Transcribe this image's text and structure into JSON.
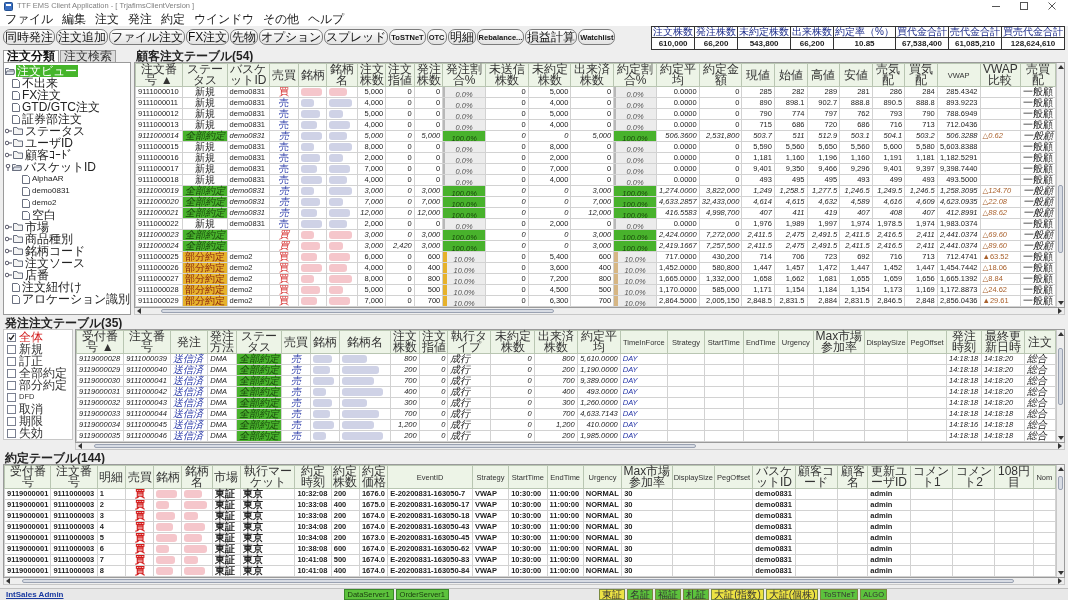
{
  "window": {
    "title": "TTF EMS Client Application - [ TrjafimsClientVersion ]"
  },
  "menu": [
    "ファイル",
    "編集",
    "注文",
    "発注",
    "約定",
    "ウインドウ",
    "その他",
    "ヘルプ"
  ],
  "toolbar": [
    "同時発注",
    "注文追加",
    "ファイル注文",
    "FX注文",
    "先物",
    "オプション",
    "スプレッド",
    "ToSTNeT",
    "OTC",
    "明細",
    "Rebalance...",
    "損益計算",
    "Watchlist"
  ],
  "summary": {
    "columns": [
      "注文株数",
      "発注株数",
      "未約定株数",
      "出来株数",
      "約定率（%）",
      "買代金合計",
      "売代金合計",
      "買売代金合計"
    ],
    "values": [
      "610,000",
      "66,200",
      "543,800",
      "66,200",
      "10.85",
      "67,538,400",
      "61,085,210",
      "128,624,610"
    ]
  },
  "left_panel": {
    "tabs": [
      {
        "label": "注文分類",
        "selected": true
      },
      {
        "label": "注文検索",
        "selected": false
      }
    ],
    "tree": [
      {
        "label": "注文ビュー",
        "kind": "folder",
        "expanded": true,
        "selected": true,
        "children": [
          {
            "label": "不出来",
            "kind": "document",
            "selected": false
          },
          {
            "label": "FX注文",
            "kind": "document",
            "selected": false
          },
          {
            "label": "GTD/GTC注文",
            "kind": "document",
            "selected": false
          },
          {
            "label": "証券部注文",
            "kind": "document",
            "selected": false
          },
          {
            "label": "ステータス",
            "kind": "folder",
            "expanded": false,
            "selected": false
          },
          {
            "label": "ユーザID",
            "kind": "folder",
            "expanded": false,
            "selected": false
          },
          {
            "label": "顧客ｺｰﾄﾞ",
            "kind": "folder",
            "expanded": false,
            "selected": false
          },
          {
            "label": "バスケットID",
            "kind": "folder",
            "expanded": true,
            "selected": false,
            "children": [
              {
                "label": "AlphaAR",
                "kind": "document",
                "selected": false
              },
              {
                "label": "demo0831",
                "kind": "document",
                "selected": false
              },
              {
                "label": "demo2",
                "kind": "document",
                "selected": false
              },
              {
                "label": "空白",
                "kind": "document",
                "selected": false
              }
            ]
          },
          {
            "label": "市場",
            "kind": "folder",
            "expanded": false,
            "selected": false
          },
          {
            "label": "商品種別",
            "kind": "folder",
            "expanded": false,
            "selected": false
          },
          {
            "label": "銘柄コード",
            "kind": "folder",
            "expanded": false,
            "selected": false
          },
          {
            "label": "注文ソース",
            "kind": "folder",
            "expanded": false,
            "selected": false
          },
          {
            "label": "店番",
            "kind": "folder",
            "expanded": false,
            "selected": false
          },
          {
            "label": "注文紐付け",
            "kind": "document",
            "selected": false
          },
          {
            "label": "アロケーション識別",
            "kind": "document",
            "selected": false
          }
        ]
      }
    ]
  },
  "customer_orders": {
    "title": "顧客注文テーブル(54)",
    "columns": [
      {
        "label": "注文番号 ▲",
        "kind": "text"
      },
      {
        "label": "ステータス",
        "kind": "status"
      },
      {
        "label": "バスケットID",
        "kind": "text"
      },
      {
        "label": "売買",
        "kind": "side"
      },
      {
        "label": "銘柄",
        "kind": "redacted"
      },
      {
        "label": "銘柄名",
        "kind": "redacted"
      },
      {
        "label": "注文株数",
        "kind": "number"
      },
      {
        "label": "注文指値",
        "kind": "number"
      },
      {
        "label": "発注株数",
        "kind": "number"
      },
      {
        "label": "発注割合%",
        "kind": "ratio"
      },
      {
        "label": "未送信株数",
        "kind": "number"
      },
      {
        "label": "未約定株数",
        "kind": "number"
      },
      {
        "label": "出来済株数",
        "kind": "number"
      },
      {
        "label": "約定割合%",
        "kind": "ratio"
      },
      {
        "label": "約定平均",
        "kind": "number"
      },
      {
        "label": "約定金額",
        "kind": "number"
      },
      {
        "label": "現値",
        "kind": "number"
      },
      {
        "label": "始値",
        "kind": "number"
      },
      {
        "label": "高値",
        "kind": "number"
      },
      {
        "label": "安値",
        "kind": "number"
      },
      {
        "label": "売気配",
        "kind": "number"
      },
      {
        "label": "買気配",
        "kind": "number"
      },
      {
        "label": "VWAP",
        "kind": "number"
      },
      {
        "label": "VWAP比較",
        "kind": "delta"
      },
      {
        "label": "売買配",
        "kind": "text"
      }
    ],
    "rows": [
      {
        "kind": "new",
        "buy": true,
        "cells": [
          "9111000010",
          "新規",
          "demo0831",
          "買",
          "",
          "",
          "5,000",
          "0",
          "0",
          "0.0%",
          "0",
          "5,000",
          "0",
          "0.0%",
          "0.0000",
          "0",
          "285",
          "282",
          "289",
          "281",
          "286",
          "284",
          "285.4342",
          "",
          "一般顧"
        ],
        "meters": [
          {
            "level": 0
          },
          {
            "level": 0
          }
        ]
      },
      {
        "kind": "new",
        "buy": false,
        "cells": [
          "9111000011",
          "新規",
          "demo0831",
          "売",
          "",
          "",
          "4,000",
          "0",
          "0",
          "0.0%",
          "0",
          "4,000",
          "0",
          "0.0%",
          "0.0000",
          "0",
          "890",
          "898.1",
          "902.7",
          "888.8",
          "890.5",
          "888.8",
          "893.9223",
          "",
          "一般顧"
        ],
        "meters": [
          {
            "level": 0
          },
          {
            "level": 0
          }
        ]
      },
      {
        "kind": "new",
        "buy": false,
        "cells": [
          "9111000012",
          "新規",
          "demo0831",
          "売",
          "",
          "",
          "5,000",
          "0",
          "0",
          "0.0%",
          "0",
          "5,000",
          "0",
          "0.0%",
          "0.0000",
          "0",
          "790",
          "774",
          "797",
          "762",
          "793",
          "790",
          "788.6949",
          "",
          "一般顧"
        ],
        "meters": [
          {
            "level": 0
          },
          {
            "level": 0
          }
        ]
      },
      {
        "kind": "new",
        "buy": false,
        "cells": [
          "9111000013",
          "新規",
          "demo0831",
          "売",
          "",
          "",
          "4,000",
          "0",
          "0",
          "0.0%",
          "0",
          "4,000",
          "0",
          "0.0%",
          "0.0000",
          "0",
          "715",
          "686",
          "720",
          "686",
          "716",
          "713",
          "712.0436",
          "",
          "一般顧"
        ],
        "meters": [
          {
            "level": 0
          },
          {
            "level": 0
          }
        ]
      },
      {
        "kind": "filled",
        "buy": false,
        "cells": [
          "9111000014",
          "全部約定",
          "demo0831",
          "売",
          "",
          "",
          "5,000",
          "0",
          "5,000",
          "100.0%",
          "0",
          "0",
          "5,000",
          "100.0%",
          "506.3600",
          "2,531,800",
          "503.7",
          "511",
          "512.9",
          "503.1",
          "504.1",
          "503.2",
          "506.3288",
          "△0.62",
          "一般顧"
        ],
        "meters": [
          {
            "level": 1
          },
          {
            "level": 1
          }
        ]
      },
      {
        "kind": "new",
        "buy": false,
        "cells": [
          "9111000015",
          "新規",
          "demo0831",
          "売",
          "",
          "",
          "8,000",
          "0",
          "0",
          "0.0%",
          "0",
          "8,000",
          "0",
          "0.0%",
          "0.0000",
          "0",
          "5,590",
          "5,560",
          "5,650",
          "5,560",
          "5,600",
          "5,580",
          "5,603.8388",
          "",
          "一般顧"
        ],
        "meters": [
          {
            "level": 0
          },
          {
            "level": 0
          }
        ]
      },
      {
        "kind": "new",
        "buy": false,
        "cells": [
          "9111000016",
          "新規",
          "demo0831",
          "売",
          "",
          "",
          "2,000",
          "0",
          "0",
          "0.0%",
          "0",
          "2,000",
          "0",
          "0.0%",
          "0.0000",
          "0",
          "1,181",
          "1,160",
          "1,196",
          "1,160",
          "1,191",
          "1,181",
          "1,182.5291",
          "",
          "一般顧"
        ],
        "meters": [
          {
            "level": 0
          },
          {
            "level": 0
          }
        ]
      },
      {
        "kind": "new",
        "buy": false,
        "cells": [
          "9111000017",
          "新規",
          "demo0831",
          "売",
          "",
          "",
          "7,000",
          "0",
          "0",
          "0.0%",
          "0",
          "7,000",
          "0",
          "0.0%",
          "0.0000",
          "0",
          "9,401",
          "9,350",
          "9,466",
          "9,296",
          "9,401",
          "9,397",
          "9,398.7440",
          "",
          "一般顧"
        ],
        "meters": [
          {
            "level": 0
          },
          {
            "level": 0
          }
        ]
      },
      {
        "kind": "new",
        "buy": false,
        "cells": [
          "9111000018",
          "新規",
          "demo0831",
          "売",
          "",
          "",
          "4,000",
          "0",
          "0",
          "0.0%",
          "0",
          "4,000",
          "0",
          "0.0%",
          "0.0000",
          "0",
          "493",
          "495",
          "495",
          "493",
          "499",
          "493",
          "493.5000",
          "",
          "一般顧"
        ],
        "meters": [
          {
            "level": 0
          },
          {
            "level": 0
          }
        ]
      },
      {
        "kind": "filled",
        "buy": false,
        "cells": [
          "9111000019",
          "全部約定",
          "demo0831",
          "売",
          "",
          "",
          "3,000",
          "0",
          "3,000",
          "100.0%",
          "0",
          "0",
          "3,000",
          "100.0%",
          "1,274.0000",
          "3,822,000",
          "1,249",
          "1,258.5",
          "1,277.5",
          "1,246.5",
          "1,249.5",
          "1,246.5",
          "1,258.3095",
          "△124.70",
          "一般顧"
        ],
        "meters": [
          {
            "level": 1
          },
          {
            "level": 1
          }
        ]
      },
      {
        "kind": "filled",
        "buy": false,
        "cells": [
          "9111000020",
          "全部約定",
          "demo0831",
          "売",
          "",
          "",
          "7,000",
          "0",
          "7,000",
          "100.0%",
          "0",
          "0",
          "7,000",
          "100.0%",
          "4,633.2857",
          "32,433,000",
          "4,614",
          "4,615",
          "4,632",
          "4,589",
          "4,616",
          "4,609",
          "4,623.0935",
          "△22.08",
          "一般顧"
        ],
        "meters": [
          {
            "level": 1
          },
          {
            "level": 1
          }
        ]
      },
      {
        "kind": "filled",
        "buy": false,
        "cells": [
          "9111000021",
          "全部約定",
          "demo0831",
          "売",
          "",
          "",
          "12,000",
          "0",
          "12,000",
          "100.0%",
          "0",
          "0",
          "12,000",
          "100.0%",
          "416.5583",
          "4,998,700",
          "407",
          "411",
          "419",
          "407",
          "408",
          "407",
          "412.8991",
          "△88.62",
          "一般顧"
        ],
        "meters": [
          {
            "level": 1
          },
          {
            "level": 1
          }
        ]
      },
      {
        "kind": "new",
        "buy": false,
        "cells": [
          "9111000022",
          "新規",
          "demo0831",
          "売",
          "",
          "",
          "2,000",
          "0",
          "0",
          "0.0%",
          "0",
          "2,000",
          "0",
          "0.0%",
          "0.0000",
          "0",
          "1,976",
          "1,989",
          "1,997",
          "1,974",
          "1,978.5",
          "1,974",
          "1,983.0374",
          "",
          "一般顧"
        ],
        "meters": [
          {
            "level": 0
          },
          {
            "level": 0
          }
        ]
      },
      {
        "kind": "filled",
        "buy": true,
        "cells": [
          "9111000023",
          "全部約定",
          "",
          "買",
          "",
          "",
          "3,000",
          "0",
          "3,000",
          "100.0%",
          "0",
          "0",
          "3,000",
          "100.0%",
          "2,424.0000",
          "7,272,000",
          "2,411.5",
          "2,475",
          "2,491.5",
          "2,411.5",
          "2,416.5",
          "2,411",
          "2,441.0374",
          "△69.60",
          "一般顧"
        ],
        "meters": [
          {
            "level": 1
          },
          {
            "level": 1
          }
        ]
      },
      {
        "kind": "filled",
        "buy": true,
        "cells": [
          "9111000024",
          "全部約定",
          "",
          "買",
          "",
          "",
          "3,000",
          "2,420",
          "3,000",
          "100.0%",
          "0",
          "0",
          "3,000",
          "100.0%",
          "2,419.1667",
          "7,257,500",
          "2,411.5",
          "2,475",
          "2,491.5",
          "2,411.5",
          "2,416.5",
          "2,411",
          "2,441.0374",
          "△89.60",
          "一般顧"
        ],
        "meters": [
          {
            "level": 1
          },
          {
            "level": 1
          }
        ]
      },
      {
        "kind": "partial",
        "buy": true,
        "cells": [
          "9111000025",
          "部分約定",
          "demo2",
          "買",
          "",
          "",
          "6,000",
          "0",
          "600",
          "10.0%",
          "0",
          "5,400",
          "600",
          "10.0%",
          "717.0000",
          "430,200",
          "714",
          "706",
          "723",
          "692",
          "716",
          "713",
          "712.4741",
          "▲63.52",
          "一般顧"
        ],
        "meters": [
          {
            "level": 0.1
          },
          {
            "level": 0.1
          }
        ]
      },
      {
        "kind": "partial",
        "buy": true,
        "cells": [
          "9111000026",
          "部分約定",
          "demo2",
          "買",
          "",
          "",
          "4,000",
          "0",
          "400",
          "10.0%",
          "0",
          "3,600",
          "400",
          "10.0%",
          "1,452.0000",
          "580,800",
          "1,447",
          "1,457",
          "1,472",
          "1,447",
          "1,452",
          "1,447",
          "1,454.7442",
          "△18.06",
          "一般顧"
        ],
        "meters": [
          {
            "level": 0.1
          },
          {
            "level": 0.1
          }
        ]
      },
      {
        "kind": "partial",
        "buy": true,
        "cells": [
          "9111000027",
          "部分約定",
          "demo2",
          "買",
          "",
          "",
          "8,000",
          "0",
          "800",
          "10.0%",
          "0",
          "7,200",
          "800",
          "10.0%",
          "1,665.0000",
          "1,332,000",
          "1,658",
          "1,662",
          "1,681",
          "1,655",
          "1,659",
          "1,656",
          "1,665.1392",
          "△8.84",
          "一般顧"
        ],
        "meters": [
          {
            "level": 0.1
          },
          {
            "level": 0.1
          }
        ]
      },
      {
        "kind": "partial",
        "buy": true,
        "cells": [
          "9111000028",
          "部分約定",
          "demo2",
          "買",
          "",
          "",
          "5,000",
          "0",
          "500",
          "10.0%",
          "0",
          "4,500",
          "500",
          "10.0%",
          "1,170.0000",
          "585,000",
          "1,171",
          "1,154",
          "1,184",
          "1,154",
          "1,173",
          "1,169",
          "1,172.8873",
          "△24.62",
          "一般顧"
        ],
        "meters": [
          {
            "level": 0.1
          },
          {
            "level": 0.1
          }
        ]
      },
      {
        "kind": "partial",
        "buy": true,
        "cells": [
          "9111000029",
          "部分約定",
          "demo2",
          "買",
          "",
          "",
          "7,000",
          "0",
          "700",
          "10.0%",
          "0",
          "6,300",
          "700",
          "10.0%",
          "2,864.5000",
          "2,005,150",
          "2,848.5",
          "2,831.5",
          "2,884",
          "2,831.5",
          "2,846.5",
          "2,848",
          "2,856.0436",
          "▲29.61",
          "一般顧"
        ],
        "meters": [
          {
            "level": 0.1
          },
          {
            "level": 0.1
          }
        ]
      }
    ]
  },
  "placed_orders": {
    "title": "発注注文テーブル(35)",
    "filters": [
      {
        "label": "全体",
        "checked": true
      },
      {
        "label": "新規",
        "checked": false
      },
      {
        "label": "訂正",
        "checked": false
      },
      {
        "label": "全部約定",
        "checked": false
      },
      {
        "label": "部分約定",
        "checked": false
      },
      {
        "label": "DFD",
        "checked": false
      },
      {
        "label": "取消",
        "checked": false
      },
      {
        "label": "期限",
        "checked": false
      },
      {
        "label": "失効",
        "checked": false
      }
    ],
    "columns": [
      {
        "label": "受付番号 ▲",
        "kind": "text"
      },
      {
        "label": "注文番号",
        "kind": "text"
      },
      {
        "label": "発注",
        "kind": "accent"
      },
      {
        "label": "発注方法",
        "kind": "text"
      },
      {
        "label": "ステータス",
        "kind": "status"
      },
      {
        "label": "売買",
        "kind": "side"
      },
      {
        "label": "銘柄",
        "kind": "redacted"
      },
      {
        "label": "銘柄名",
        "kind": "redacted"
      },
      {
        "label": "注文株数",
        "kind": "number"
      },
      {
        "label": "注文指値",
        "kind": "number"
      },
      {
        "label": "執行タイプ",
        "kind": "text"
      },
      {
        "label": "未約定株数",
        "kind": "number"
      },
      {
        "label": "出来済株数",
        "kind": "number"
      },
      {
        "label": "約定平均",
        "kind": "number"
      },
      {
        "label": "TimeInForce",
        "kind": "accent"
      },
      {
        "label": "Strategy",
        "kind": "text"
      },
      {
        "label": "StartTime",
        "kind": "text"
      },
      {
        "label": "EndTime",
        "kind": "text"
      },
      {
        "label": "Urgency",
        "kind": "text"
      },
      {
        "label": "Max市場参加率",
        "kind": "text"
      },
      {
        "label": "DisplaySize",
        "kind": "text"
      },
      {
        "label": "PegOffset",
        "kind": "text"
      },
      {
        "label": "発注時刻",
        "kind": "text"
      },
      {
        "label": "最終更新日時",
        "kind": "text"
      },
      {
        "label": "注文",
        "kind": "text"
      }
    ],
    "rows": [
      {
        "kind": "filled",
        "buy": false,
        "cells": [
          "9119000028",
          "9111000039",
          "送信済",
          "DMA",
          "全部約定",
          "売",
          "",
          "",
          "800",
          "0",
          "成行",
          "0",
          "800",
          "5,610.0000",
          "DAY",
          "",
          "",
          "",
          "",
          "",
          "",
          "",
          "14:18:18",
          "14:18:20",
          "総合"
        ]
      },
      {
        "kind": "filled",
        "buy": false,
        "cells": [
          "9119000029",
          "9111000040",
          "送信済",
          "DMA",
          "全部約定",
          "売",
          "",
          "",
          "200",
          "0",
          "成行",
          "0",
          "200",
          "1,190.0000",
          "DAY",
          "",
          "",
          "",
          "",
          "",
          "",
          "",
          "14:18:18",
          "14:18:20",
          "総合"
        ]
      },
      {
        "kind": "filled",
        "buy": false,
        "cells": [
          "9119000030",
          "9111000041",
          "送信済",
          "DMA",
          "全部約定",
          "売",
          "",
          "",
          "700",
          "0",
          "成行",
          "0",
          "700",
          "9,389.0000",
          "DAY",
          "",
          "",
          "",
          "",
          "",
          "",
          "",
          "14:18:18",
          "14:18:20",
          "総合"
        ]
      },
      {
        "kind": "filled",
        "buy": false,
        "cells": [
          "9119000031",
          "9111000042",
          "送信済",
          "DMA",
          "全部約定",
          "売",
          "",
          "",
          "400",
          "0",
          "成行",
          "0",
          "400",
          "493.0000",
          "DAY",
          "",
          "",
          "",
          "",
          "",
          "",
          "",
          "14:18:18",
          "14:18:20",
          "総合"
        ]
      },
      {
        "kind": "filled",
        "buy": false,
        "cells": [
          "9119000032",
          "9111000043",
          "送信済",
          "DMA",
          "全部約定",
          "売",
          "",
          "",
          "300",
          "0",
          "成行",
          "0",
          "300",
          "1,260.0000",
          "DAY",
          "",
          "",
          "",
          "",
          "",
          "",
          "",
          "14:18:18",
          "14:18:20",
          "総合"
        ]
      },
      {
        "kind": "filled",
        "buy": false,
        "cells": [
          "9119000033",
          "9111000044",
          "送信済",
          "DMA",
          "全部約定",
          "売",
          "",
          "",
          "700",
          "0",
          "成行",
          "0",
          "700",
          "4,633.7143",
          "DAY",
          "",
          "",
          "",
          "",
          "",
          "",
          "",
          "14:18:18",
          "14:18:18",
          "総合"
        ]
      },
      {
        "kind": "filled",
        "buy": false,
        "cells": [
          "9119000034",
          "9111000045",
          "送信済",
          "DMA",
          "全部約定",
          "売",
          "",
          "",
          "1,200",
          "0",
          "成行",
          "0",
          "1,200",
          "410.0000",
          "DAY",
          "",
          "",
          "",
          "",
          "",
          "",
          "",
          "14:18:16",
          "14:18:18",
          "総合"
        ]
      },
      {
        "kind": "filled",
        "buy": false,
        "cells": [
          "9119000035",
          "9111000046",
          "送信済",
          "DMA",
          "全部約定",
          "売",
          "",
          "",
          "200",
          "0",
          "成行",
          "0",
          "200",
          "1,985.0000",
          "DAY",
          "",
          "",
          "",
          "",
          "",
          "",
          "",
          "14:18:18",
          "14:18:18",
          "総合"
        ]
      }
    ]
  },
  "executions": {
    "title": "約定テーブル(144)",
    "columns": [
      {
        "label": "受付番号",
        "kind": "text"
      },
      {
        "label": "注文番号",
        "kind": "text"
      },
      {
        "label": "明細",
        "kind": "text"
      },
      {
        "label": "売買",
        "kind": "side"
      },
      {
        "label": "銘柄",
        "kind": "redacted"
      },
      {
        "label": "銘柄名",
        "kind": "redacted"
      },
      {
        "label": "市場",
        "kind": "text"
      },
      {
        "label": "執行マーケット",
        "kind": "text"
      },
      {
        "label": "約定時刻",
        "kind": "text"
      },
      {
        "label": "約定株数",
        "kind": "text"
      },
      {
        "label": "約定価格",
        "kind": "text"
      },
      {
        "label": "EventID",
        "kind": "text"
      },
      {
        "label": "Strategy",
        "kind": "text"
      },
      {
        "label": "StartTime",
        "kind": "text"
      },
      {
        "label": "EndTime",
        "kind": "text"
      },
      {
        "label": "Urgency",
        "kind": "text"
      },
      {
        "label": "Max市場参加率",
        "kind": "text"
      },
      {
        "label": "DisplaySize",
        "kind": "text"
      },
      {
        "label": "PegOffset",
        "kind": "text"
      },
      {
        "label": "バスケットID",
        "kind": "text"
      },
      {
        "label": "顧客コード",
        "kind": "text"
      },
      {
        "label": "顧客名",
        "kind": "text"
      },
      {
        "label": "更新ユーザID",
        "kind": "text"
      },
      {
        "label": "コメント1",
        "kind": "text"
      },
      {
        "label": "コメント2",
        "kind": "text"
      },
      {
        "label": "108円目",
        "kind": "text"
      },
      {
        "label": "Nom",
        "kind": "text"
      }
    ],
    "rows": [
      {
        "buy": true,
        "cells": [
          "9119000001",
          "9111000003",
          "1",
          "買",
          "",
          "",
          "東証",
          "東京",
          "10:32:08",
          "200",
          "1676.0",
          "E-20200831-163050-7",
          "VWAP",
          "10:30:00",
          "11:00:00",
          "NORMAL",
          "30",
          "",
          "",
          "demo0831",
          "",
          "",
          "admin",
          "",
          "",
          "",
          ""
        ]
      },
      {
        "buy": true,
        "cells": [
          "9119000001",
          "9111000003",
          "2",
          "買",
          "",
          "",
          "東証",
          "東京",
          "10:33:08",
          "400",
          "1675.0",
          "E-20200831-163050-17",
          "VWAP",
          "10:30:00",
          "11:00:00",
          "NORMAL",
          "30",
          "",
          "",
          "demo0831",
          "",
          "",
          "admin",
          "",
          "",
          "",
          ""
        ]
      },
      {
        "buy": true,
        "cells": [
          "9119000001",
          "9111000003",
          "3",
          "買",
          "",
          "",
          "東証",
          "東京",
          "10:33:08",
          "200",
          "1674.0",
          "E-20200831-163050-18",
          "VWAP",
          "10:30:00",
          "11:00:00",
          "NORMAL",
          "30",
          "",
          "",
          "demo0831",
          "",
          "",
          "admin",
          "",
          "",
          "",
          ""
        ]
      },
      {
        "buy": true,
        "cells": [
          "9119000001",
          "9111000003",
          "4",
          "買",
          "",
          "",
          "東証",
          "東京",
          "10:34:08",
          "200",
          "1674.0",
          "E-20200831-163050-43",
          "VWAP",
          "10:30:00",
          "11:00:00",
          "NORMAL",
          "30",
          "",
          "",
          "demo0831",
          "",
          "",
          "admin",
          "",
          "",
          "",
          ""
        ]
      },
      {
        "buy": true,
        "cells": [
          "9119000001",
          "9111000003",
          "5",
          "買",
          "",
          "",
          "東証",
          "東京",
          "10:34:08",
          "200",
          "1673.0",
          "E-20200831-163050-45",
          "VWAP",
          "10:30:00",
          "11:00:00",
          "NORMAL",
          "30",
          "",
          "",
          "demo0831",
          "",
          "",
          "admin",
          "",
          "",
          "",
          ""
        ]
      },
      {
        "buy": true,
        "cells": [
          "9119000001",
          "9111000003",
          "6",
          "買",
          "",
          "",
          "東証",
          "東京",
          "10:38:08",
          "600",
          "1674.0",
          "E-20200831-163050-62",
          "VWAP",
          "10:30:00",
          "11:00:00",
          "NORMAL",
          "30",
          "",
          "",
          "demo0831",
          "",
          "",
          "admin",
          "",
          "",
          "",
          ""
        ]
      },
      {
        "buy": true,
        "cells": [
          "9119000001",
          "9111000003",
          "7",
          "買",
          "",
          "",
          "東証",
          "東京",
          "10:41:08",
          "500",
          "1674.0",
          "E-20200831-163050-83",
          "VWAP",
          "10:30:00",
          "11:00:00",
          "NORMAL",
          "30",
          "",
          "",
          "demo0831",
          "",
          "",
          "admin",
          "",
          "",
          "",
          ""
        ]
      },
      {
        "buy": true,
        "cells": [
          "9119000001",
          "9111000003",
          "8",
          "買",
          "",
          "",
          "東証",
          "東京",
          "10:41:08",
          "400",
          "1674.0",
          "E-20200831-163050-84",
          "VWAP",
          "10:30:00",
          "11:00:00",
          "NORMAL",
          "30",
          "",
          "",
          "demo0831",
          "",
          "",
          "admin",
          "",
          "",
          "",
          ""
        ]
      }
    ]
  },
  "status_bar": {
    "user": "IntSales Admin",
    "servers": [
      "DataServer1",
      "OrderServer1"
    ],
    "markets": [
      {
        "label": "東証",
        "color": "#ece244"
      },
      {
        "label": "名証",
        "color": "#5cc23c"
      },
      {
        "label": "福証",
        "color": "#5cc23c"
      },
      {
        "label": "札証",
        "color": "#5cc23c"
      },
      {
        "label": "大証(指数)",
        "color": "#ece244"
      },
      {
        "label": "大証(個株)",
        "color": "#ece244"
      },
      {
        "label": "ToSTNeT",
        "color": "#5cc23c"
      },
      {
        "label": "ALGO",
        "color": "#5cc23c"
      }
    ]
  }
}
